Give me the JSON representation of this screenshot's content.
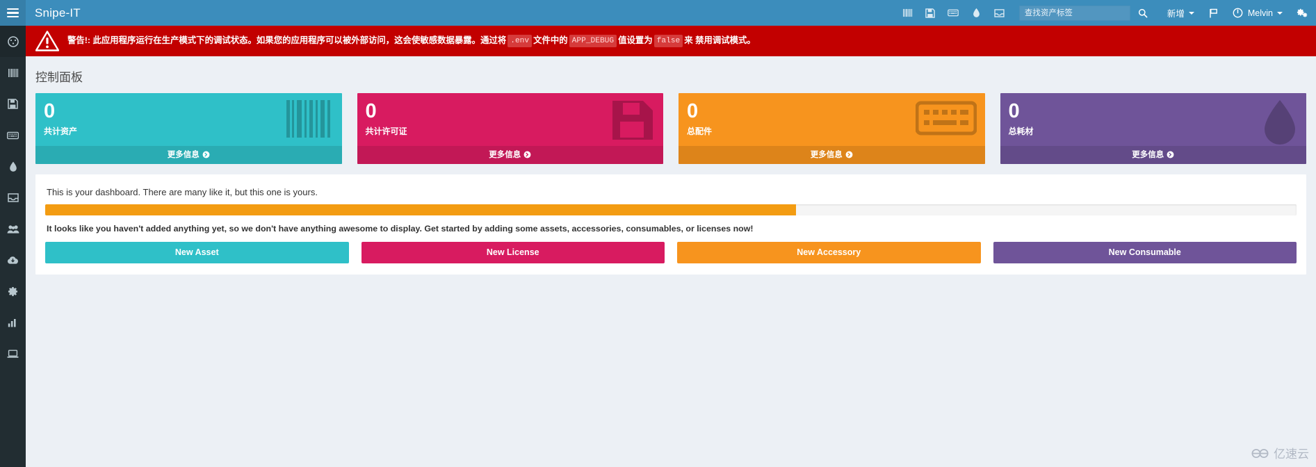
{
  "app": {
    "brand": "Snipe-IT",
    "accent": "#3c8dbc",
    "sidebar_bg": "#222d32",
    "page_bg": "#ecf0f5"
  },
  "sidebar": {
    "menu_toggle_name": "hamburger-menu",
    "items": [
      {
        "icon": "dashboard-icon",
        "name": "sidebar-item-dashboard",
        "active": true
      },
      {
        "icon": "barcode-icon",
        "name": "sidebar-item-assets",
        "active": false
      },
      {
        "icon": "floppy-disk-icon",
        "name": "sidebar-item-licenses",
        "active": false
      },
      {
        "icon": "keyboard-icon",
        "name": "sidebar-item-accessories",
        "active": false
      },
      {
        "icon": "droplet-icon",
        "name": "sidebar-item-consumables",
        "active": false
      },
      {
        "icon": "inbox-icon",
        "name": "sidebar-item-components",
        "active": false
      },
      {
        "icon": "users-icon",
        "name": "sidebar-item-people",
        "active": false
      },
      {
        "icon": "cloud-download-icon",
        "name": "sidebar-item-import",
        "active": false
      },
      {
        "icon": "gear-icon",
        "name": "sidebar-item-settings",
        "active": false
      },
      {
        "icon": "bar-chart-icon",
        "name": "sidebar-item-reports",
        "active": false
      },
      {
        "icon": "laptop-icon",
        "name": "sidebar-item-requestable",
        "active": false
      }
    ]
  },
  "navbar": {
    "icons": [
      {
        "icon": "barcode-icon",
        "name": "navbar-assets-icon"
      },
      {
        "icon": "floppy-disk-icon",
        "name": "navbar-licenses-icon"
      },
      {
        "icon": "keyboard-icon",
        "name": "navbar-accessories-icon"
      },
      {
        "icon": "droplet-icon",
        "name": "navbar-consumables-icon"
      },
      {
        "icon": "inbox-icon",
        "name": "navbar-components-icon"
      }
    ],
    "search": {
      "placeholder": "查找资产标签",
      "value": "",
      "button_icon": "search-icon"
    },
    "create_new_label": "新增",
    "flag_icon": "flag-icon",
    "power_icon": "power-icon",
    "user_name": "Melvin",
    "settings_icon": "gears-icon"
  },
  "alert": {
    "icon": "warning-triangle-icon",
    "prefix": "警告!:",
    "part1": "此应用程序运行在生产模式下的调试状态。如果您的应用程序可以被外部访问，这会使敏感数据暴露。通过将",
    "code1": ".env",
    "part2": "文件中的",
    "code2": "APP_DEBUG",
    "part3": "值设置为",
    "code3": "false",
    "part4": "来 禁用调试模式。"
  },
  "page": {
    "title": "控制面板"
  },
  "cards": [
    {
      "name": "stat-card-assets",
      "count": "0",
      "label": "共计资产",
      "more_label": "更多信息",
      "color": "#2fc0c8",
      "icon": "barcode-icon"
    },
    {
      "name": "stat-card-licenses",
      "count": "0",
      "label": "共计许可证",
      "more_label": "更多信息",
      "color": "#d81b60",
      "icon": "floppy-disk-icon"
    },
    {
      "name": "stat-card-accessories",
      "count": "0",
      "label": "总配件",
      "more_label": "更多信息",
      "color": "#f7941e",
      "icon": "keyboard-icon"
    },
    {
      "name": "stat-card-consumables",
      "count": "0",
      "label": "总耗材",
      "more_label": "更多信息",
      "color": "#6f5499",
      "icon": "droplet-icon"
    }
  ],
  "panel": {
    "lead": "This is your dashboard. There are many like it, but this one is yours.",
    "progress_percent": 60,
    "progress_color": "#f39c12",
    "message": "It looks like you haven't added anything yet, so we don't have anything awesome to display. Get started by adding some assets, accessories, consumables, or licenses now!",
    "buttons": [
      {
        "label": "New Asset",
        "color": "#2fc0c8",
        "name": "new-asset-button"
      },
      {
        "label": "New License",
        "color": "#d81b60",
        "name": "new-license-button"
      },
      {
        "label": "New Accessory",
        "color": "#f7941e",
        "name": "new-accessory-button"
      },
      {
        "label": "New Consumable",
        "color": "#6f5499",
        "name": "new-consumable-button"
      }
    ]
  },
  "watermark": {
    "text": "亿速云",
    "icon": "cloud-logo-icon"
  }
}
